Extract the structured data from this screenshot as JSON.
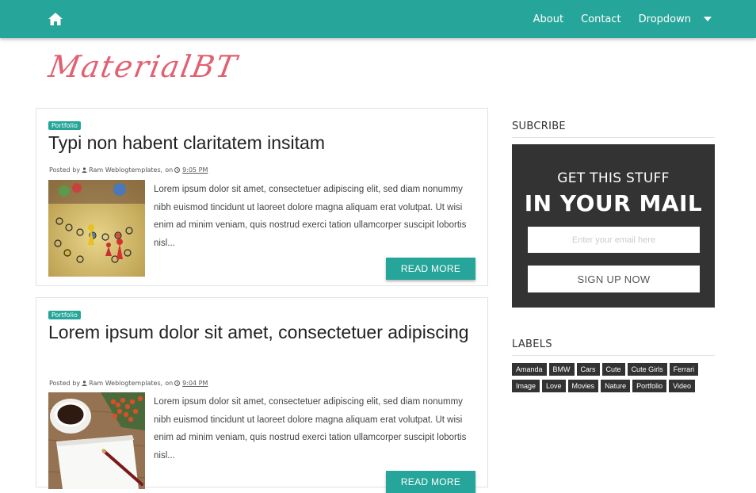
{
  "nav": {
    "items": [
      {
        "label": "About"
      },
      {
        "label": "Contact"
      },
      {
        "label": "Dropdown"
      }
    ]
  },
  "logo": {
    "text": "MaterialBT"
  },
  "posts": [
    {
      "label": "Portfolio",
      "title": "Typi non habent claritatem insitam",
      "posted_by": "Posted by",
      "author": "Ram Weblogtemplates,",
      "on": "on",
      "time": "9:05 PM",
      "snippet": "Lorem ipsum dolor sit amet, consectetuer adipiscing elit, sed diam nonummy nibh euismod tincidunt ut laoreet dolore magna aliquam erat volutpat. Ut wisi enim ad minim veniam, quis nostrud exerci tation ullamcorper suscipit lobortis nisl...",
      "read_more": "READ MORE"
    },
    {
      "label": "Portfolio",
      "title": "Lorem ipsum dolor sit amet, consectetuer adipiscing",
      "posted_by": "Posted by",
      "author": "Ram Weblogtemplates,",
      "on": "on",
      "time": "9:04 PM",
      "snippet": "Lorem ipsum dolor sit amet, consectetuer adipiscing elit, sed diam nonummy nibh euismod tincidunt ut laoreet dolore magna aliquam erat volutpat. Ut wisi enim ad minim veniam, quis nostrud exerci tation ullamcorper suscipit lobortis nisl...",
      "read_more": "READ MORE"
    }
  ],
  "sidebar": {
    "subscribe": {
      "title": "SUBCRIBE",
      "line1": "GET THIS STUFF",
      "line2": "IN YOUR MAIL",
      "placeholder": "Enter your email here",
      "button": "SIGN UP NOW"
    },
    "labels": {
      "title": "LABELS",
      "items": [
        "Amanda",
        "BMW",
        "Cars",
        "Cute",
        "Cute Girls",
        "Ferrari",
        "Image",
        "Love",
        "Movies",
        "Nature",
        "Portfolio",
        "Video"
      ]
    }
  },
  "colors": {
    "accent": "#26a69a",
    "logo": "#e06171",
    "dark": "#333333"
  },
  "icons": [
    "home-icon",
    "caret-down-icon",
    "user-icon",
    "clock-icon"
  ]
}
